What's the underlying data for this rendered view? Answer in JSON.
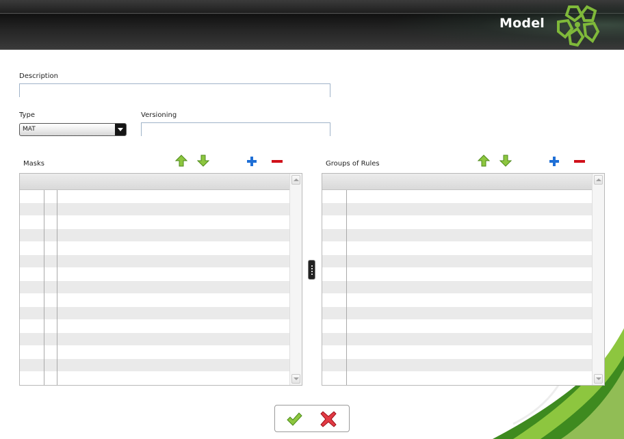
{
  "header": {
    "title": "Model"
  },
  "form": {
    "description_label": "Description",
    "description_value": "",
    "type_label": "Type",
    "type_selected": "MAT",
    "versioning_label": "Versioning",
    "versioning_value": ""
  },
  "masks_panel": {
    "title": "Masks",
    "toolbar": [
      "move-up-icon",
      "move-down-icon",
      "add-icon",
      "remove-icon"
    ]
  },
  "rules_panel": {
    "title": "Groups of Rules",
    "toolbar": [
      "move-up-icon",
      "move-down-icon",
      "add-icon",
      "remove-icon"
    ]
  },
  "colors": {
    "accent_green": "#8dc63f",
    "logo_green": "#7fb93a",
    "header_dark": "#1d1d1d",
    "add_blue": "#1f6fd6",
    "remove_red": "#d0101a",
    "row_alt": "#eaeaea"
  },
  "actions": {
    "confirm_icon": "checkmark-icon",
    "cancel_icon": "cross-icon"
  }
}
